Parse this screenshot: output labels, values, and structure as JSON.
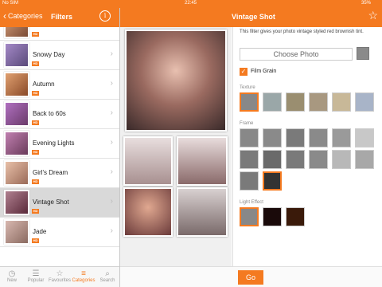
{
  "status": {
    "carrier": "No SIM",
    "time": "22:45",
    "battery": "35%"
  },
  "nav_left": {
    "back_label": "Categories",
    "title": "Filters",
    "info_icon": "info-icon"
  },
  "nav_right": {
    "title": "Vintage Shot",
    "star_icon": "star-icon"
  },
  "filters": [
    {
      "label": "",
      "badge": "HD"
    },
    {
      "label": "Snowy Day",
      "badge": "HD"
    },
    {
      "label": "Autumn",
      "badge": "HD"
    },
    {
      "label": "Back to 60s",
      "badge": "HD"
    },
    {
      "label": "Evening Lights",
      "badge": "HD"
    },
    {
      "label": "Girl's Dream",
      "badge": "HD"
    },
    {
      "label": "Vintage Shot",
      "badge": "HD"
    },
    {
      "label": "Jade",
      "badge": "HD"
    }
  ],
  "tabs": [
    {
      "label": "New",
      "icon": "clock-icon"
    },
    {
      "label": "Popular",
      "icon": "list-icon"
    },
    {
      "label": "Favourites",
      "icon": "star-icon"
    },
    {
      "label": "Categories",
      "icon": "menu-icon"
    },
    {
      "label": "Search",
      "icon": "search-icon"
    }
  ],
  "panel": {
    "description": "This filter gives your photo vintage styled red brownish tint.",
    "choose_photo": "Choose Photo",
    "film_grain": "Film Grain",
    "texture_label": "Texture",
    "frame_label": "Frame",
    "light_label": "Light Effect"
  },
  "go_button": "Go",
  "colors": {
    "accent": "#f47a20"
  }
}
